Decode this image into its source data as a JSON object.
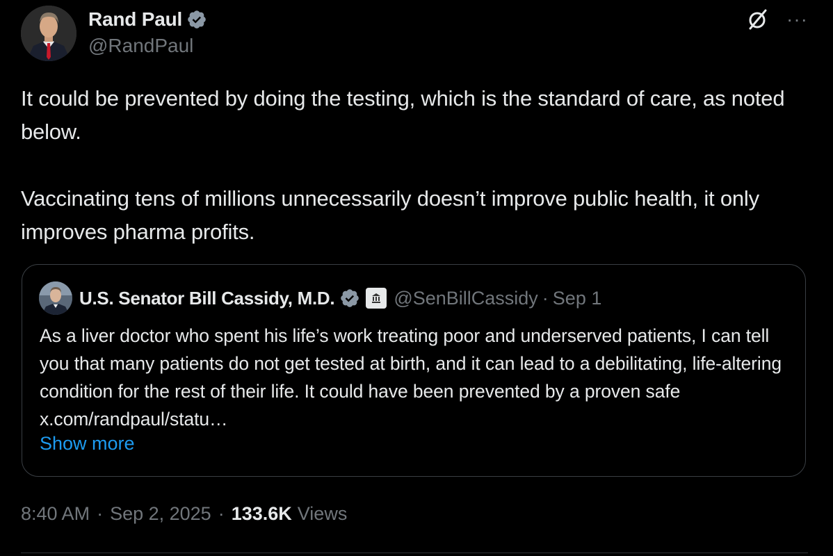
{
  "author": {
    "name": "Rand Paul",
    "handle": "@RandPaul"
  },
  "tweet": {
    "text": "It could be prevented by doing the testing, which is the standard of care, as noted below.\n\nVaccinating tens of millions unnecessarily doesn’t improve public health, it only improves pharma profits."
  },
  "quote": {
    "name": "U.S. Senator Bill Cassidy, M.D.",
    "handle": "@SenBillCassidy",
    "separator": "·",
    "date": "Sep 1",
    "text": "As a liver doctor who spent his life’s work treating poor and underserved patients, I can tell you that many patients do not get tested at birth, and it can lead to a debilitating, life-altering condition for the rest of their life. It could have been prevented by a proven safe x.com/randpaul/statu…",
    "show_more": "Show more"
  },
  "meta": {
    "time": "8:40 AM",
    "separator": "·",
    "date": "Sep 2, 2025",
    "views_count": "133.6K",
    "views_label": "Views"
  },
  "icons": {
    "verified": "verified-badge-icon",
    "grok": "grok-icon",
    "more": "more-icon",
    "government": "government-badge-icon"
  },
  "colors": {
    "background": "#000000",
    "text": "#e7e9ea",
    "muted": "#71767b",
    "link": "#1d9bf0",
    "verified": "#8b98a5",
    "border": "#3a3f44"
  }
}
